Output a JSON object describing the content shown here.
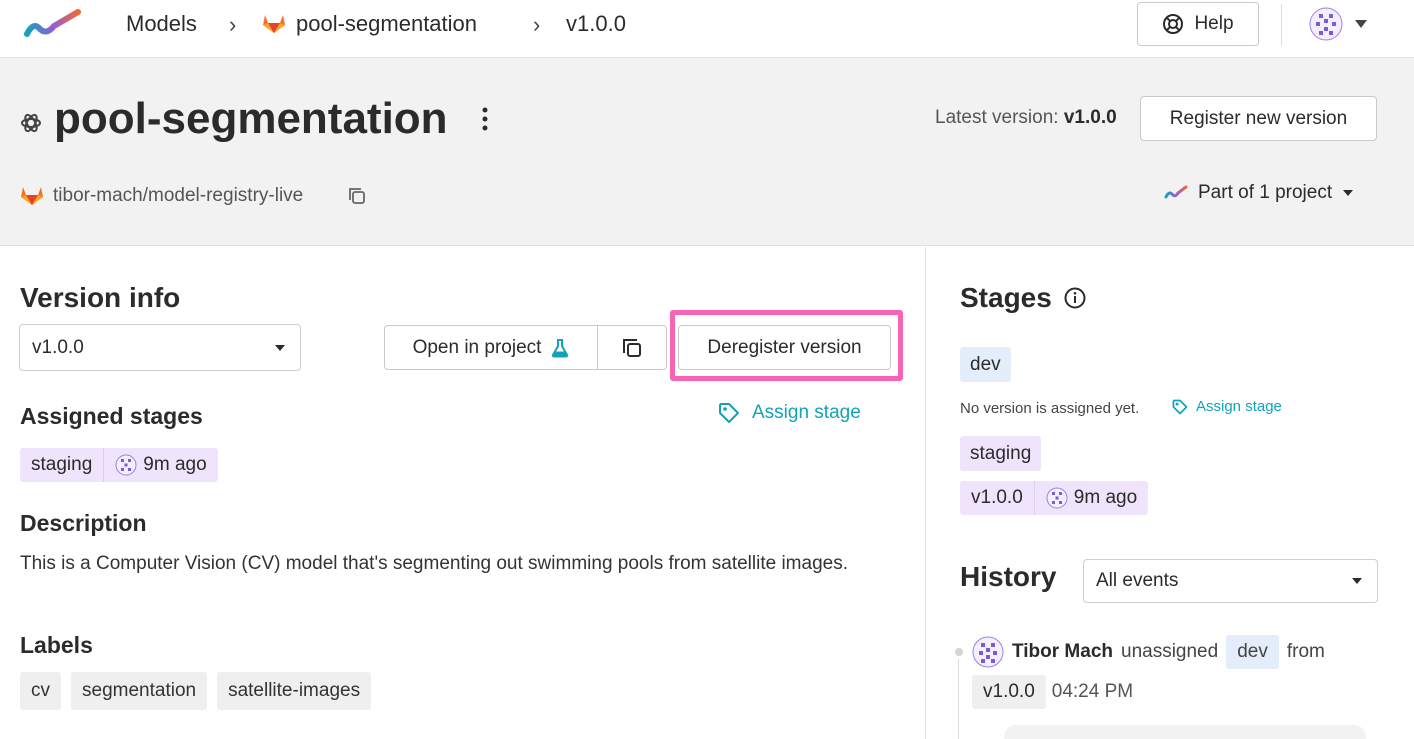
{
  "nav": {
    "breadcrumbs": [
      "Models",
      "pool-segmentation",
      "v1.0.0"
    ],
    "help_label": "Help"
  },
  "header": {
    "model_name": "pool-segmentation",
    "latest_label": "Latest version:",
    "latest_version": "v1.0.0",
    "register_button": "Register new version",
    "repo": "tibor-mach/model-registry-live",
    "part_of": "Part of 1 project"
  },
  "version_info": {
    "title": "Version info",
    "selected_version": "v1.0.0",
    "open_in_project": "Open in project",
    "deregister": "Deregister version",
    "assigned_stages_title": "Assigned stages",
    "assign_stage": "Assign stage",
    "assigned": {
      "stage": "staging",
      "time": "9m ago"
    },
    "description_title": "Description",
    "description": "This is a Computer Vision (CV) model that's segmenting out swimming pools from satellite images.",
    "labels_title": "Labels",
    "labels": [
      "cv",
      "segmentation",
      "satellite-images"
    ]
  },
  "stages": {
    "title": "Stages",
    "dev": "dev",
    "no_version": "No version is assigned yet.",
    "assign_stage": "Assign stage",
    "staging": "staging",
    "staging_version": "v1.0.0",
    "staging_time": "9m ago"
  },
  "history": {
    "title": "History",
    "filter": "All events",
    "event": {
      "user": "Tibor Mach",
      "action": "unassigned",
      "stage": "dev",
      "from": "from",
      "version": "v1.0.0",
      "time": "04:24 PM"
    }
  },
  "colors": {
    "accent_teal": "#13a3b8",
    "highlight_pink": "#f864b4",
    "stage_purple": "#efe4fb",
    "stage_blue": "#e3eefa"
  }
}
